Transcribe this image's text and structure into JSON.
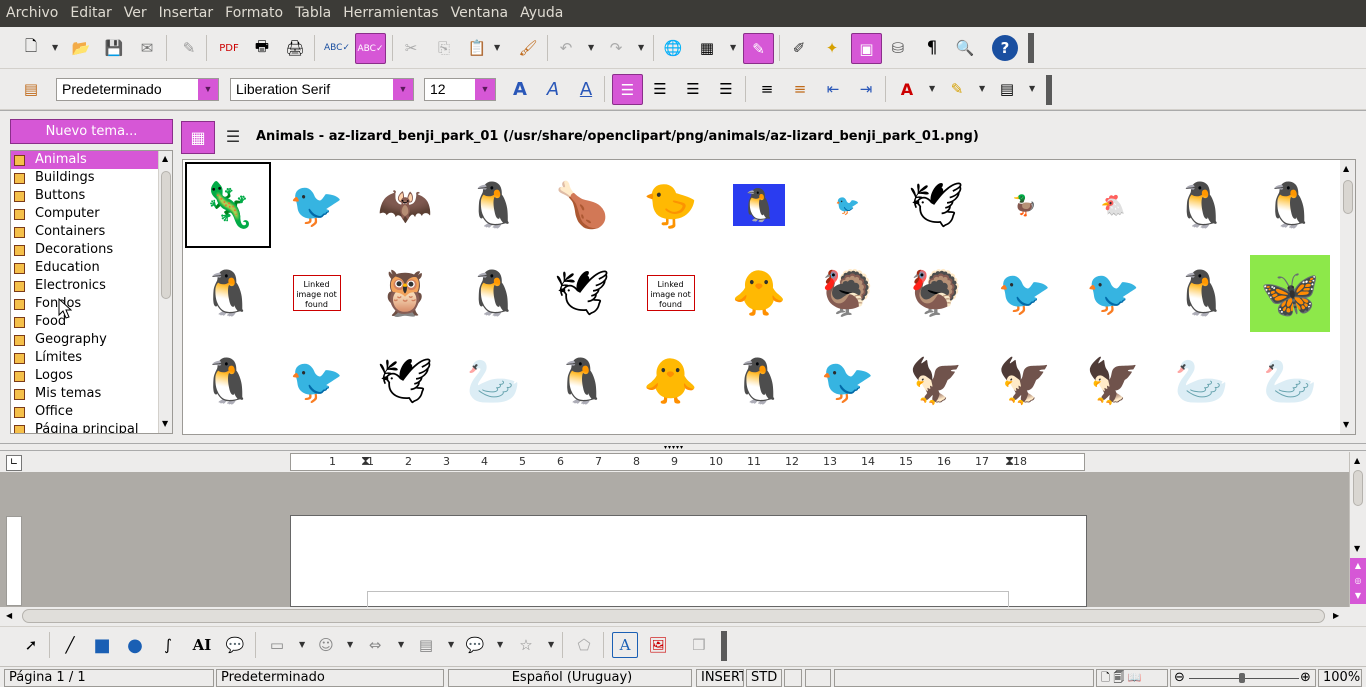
{
  "menu": [
    "Archivo",
    "Editar",
    "Ver",
    "Insertar",
    "Formato",
    "Tabla",
    "Herramientas",
    "Ventana",
    "Ayuda"
  ],
  "formatting": {
    "paragraph_style": "Predeterminado",
    "font_name": "Liberation Serif",
    "font_size": "12"
  },
  "gallery": {
    "new_theme_label": "Nuevo tema...",
    "path_label": "Animals - az-lizard_benji_park_01 (/usr/share/openclipart/png/animals/az-lizard_benji_park_01.png)",
    "themes": [
      "Animals",
      "Buildings",
      "Buttons",
      "Computer",
      "Containers",
      "Decorations",
      "Education",
      "Electronics",
      "Fondos",
      "Food",
      "Geography",
      "Límites",
      "Logos",
      "Mis temas",
      "Office",
      "Página principal"
    ],
    "selected_theme": "Animals",
    "thumbnails": [
      {
        "icon": "lizard"
      },
      {
        "icon": "cormorant"
      },
      {
        "icon": "bat"
      },
      {
        "icon": "puffin"
      },
      {
        "icon": "roast-turkey"
      },
      {
        "icon": "yellow-bird"
      },
      {
        "icon": "penguin-blue-tile"
      },
      {
        "icon": "small-bird"
      },
      {
        "icon": "seagull"
      },
      {
        "icon": "duck"
      },
      {
        "icon": "hen"
      },
      {
        "icon": "penguin"
      },
      {
        "icon": "penguin-large"
      },
      {
        "icon": "penguin-small"
      },
      {
        "icon": "linked-image-not-found",
        "text": "Linked image not found"
      },
      {
        "icon": "owl"
      },
      {
        "icon": "penguin"
      },
      {
        "icon": "dove"
      },
      {
        "icon": "linked-image-not-found",
        "text": "Linked image not found"
      },
      {
        "icon": "gosling"
      },
      {
        "icon": "turkey"
      },
      {
        "icon": "turkey-orange"
      },
      {
        "icon": "crow"
      },
      {
        "icon": "raven"
      },
      {
        "icon": "penguin-cap"
      },
      {
        "icon": "butterfly-flowers"
      },
      {
        "icon": "penguin-cap"
      },
      {
        "icon": "flying-bird"
      },
      {
        "icon": "gull-flying"
      },
      {
        "icon": "goose"
      },
      {
        "icon": "emperor-penguin"
      },
      {
        "icon": "duckling"
      },
      {
        "icon": "emperor-penguin"
      },
      {
        "icon": "red-bird"
      },
      {
        "icon": "eagle-head"
      },
      {
        "icon": "eagle-flying"
      },
      {
        "icon": "eagle-standing"
      },
      {
        "icon": "swans-blue"
      },
      {
        "icon": "swan-black"
      }
    ]
  },
  "ruler_labels": [
    "1",
    "1",
    "2",
    "3",
    "4",
    "5",
    "6",
    "7",
    "8",
    "9",
    "10",
    "11",
    "12",
    "13",
    "14",
    "15",
    "16",
    "17",
    "18"
  ],
  "status": {
    "page": "Página  1 / 1",
    "style": "Predeterminado",
    "language": "Español (Uruguay)",
    "insert_mode": "INSERT",
    "selection_mode": "STD",
    "zoom": "100%"
  }
}
